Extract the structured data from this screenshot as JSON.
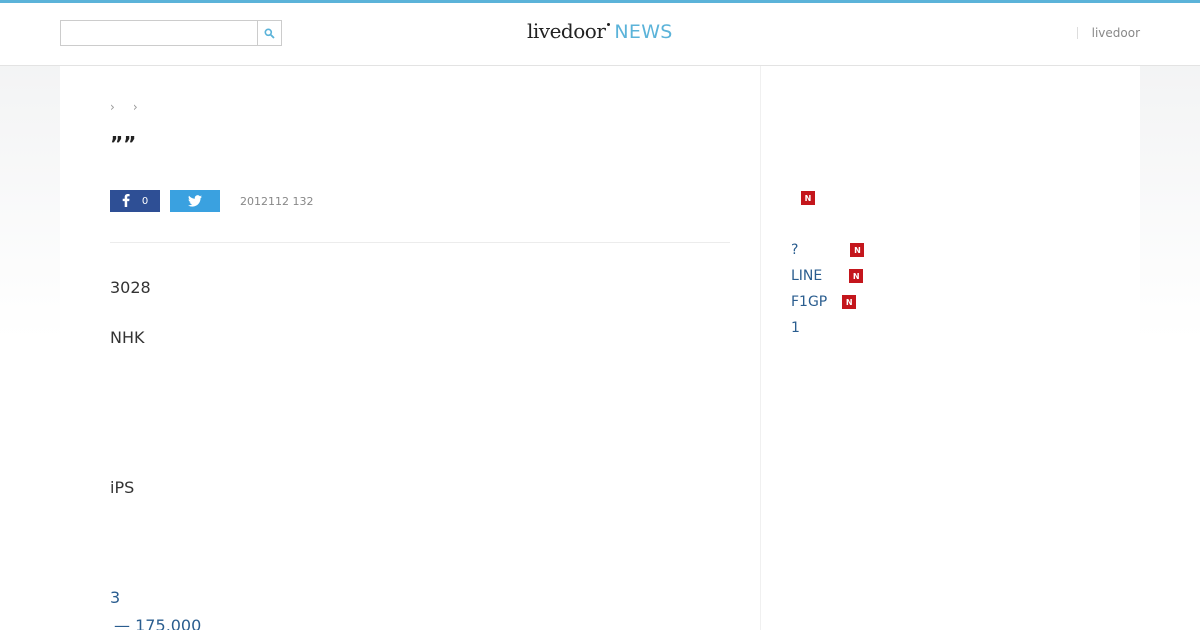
{
  "colors": {
    "accent": "#5bb3d9",
    "facebook": "#2e4f95",
    "twitter": "#3aa1e0",
    "badge": "#c4161c",
    "link": "#2a5d8f"
  },
  "header": {
    "search": {
      "value": "",
      "placeholder": ""
    },
    "logo": {
      "brand": "livedoor",
      "section": "NEWS"
    },
    "right_link": "livedoor"
  },
  "article": {
    "title": "””",
    "share": {
      "facebook_count": "0"
    },
    "date": "2012112 132",
    "paragraphs": [
      "3028",
      "NHK",
      "iPS"
    ],
    "links": [
      "3",
      "— 175,000"
    ]
  },
  "sidebar": {
    "badge_label": "N",
    "items": [
      {
        "label": "?",
        "badge": true
      },
      {
        "label": "LINE",
        "badge": true
      },
      {
        "label": "F1GP",
        "badge": true
      },
      {
        "label": "1",
        "badge": false
      }
    ]
  }
}
